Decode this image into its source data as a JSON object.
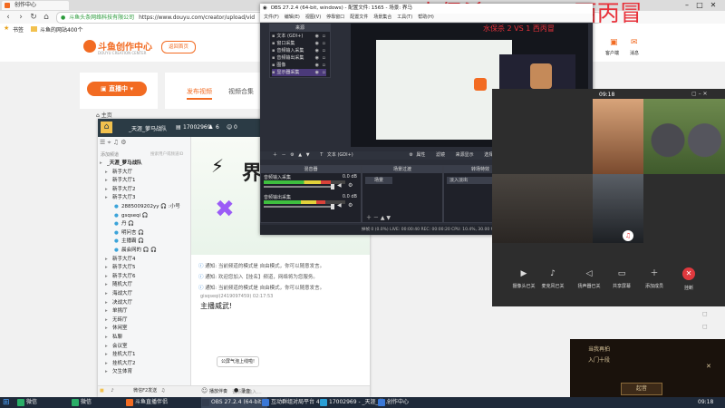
{
  "browser": {
    "tabs": [
      {
        "label": "创作中心"
      }
    ],
    "address": "https://www.douyu.com/creator/upload/vid",
    "address_prefix": "斗鱼头条网络科技有限公司",
    "bookmarks": [
      {
        "label": "书签"
      },
      {
        "label": "斗鱼的网站400个"
      }
    ]
  },
  "site": {
    "logo": "斗鱼创作中心",
    "logo_sub": "DOUYU CREATION CENTER",
    "back_btn": "返回首页",
    "live_btn": "直播中",
    "tab_upload": "发布视频",
    "tab_collection": "视频合集",
    "home": "主页",
    "right_icons": [
      {
        "label": "客户端"
      },
      {
        "label": "消息"
      }
    ]
  },
  "overlay_title": "水保杀 2 VS 1 西丙冒",
  "chat": {
    "channel_name": "_天涯_萝马战队",
    "channel_id": "17002969",
    "member_count": "6",
    "online": "0",
    "search_placeholder": "搜索用户或频道ID",
    "section_label": "添加频道",
    "channels": [
      {
        "label": "_天涯_萝马战队"
      },
      {
        "label": "新手大厅"
      },
      {
        "label": "新手大厅1"
      },
      {
        "label": "新手大厅2"
      },
      {
        "label": "新手大厅3"
      },
      {
        "label": "2885009202yy 🎧 :小号"
      },
      {
        "label": "gsqseqi 🎧"
      },
      {
        "label": "丹 🎧"
      },
      {
        "label": "明问言 🎧"
      },
      {
        "label": "主播霸 🎧"
      },
      {
        "label": "晨会网的 🎧 🎧"
      },
      {
        "label": "新手大厅4"
      },
      {
        "label": "新手大厅5"
      },
      {
        "label": "新手大厅6"
      },
      {
        "label": "随机大厅"
      },
      {
        "label": "海战大厅"
      },
      {
        "label": "决战大厅"
      },
      {
        "label": "单挑厅"
      },
      {
        "label": "无砖厅"
      },
      {
        "label": "休闲室"
      },
      {
        "label": "私聊"
      },
      {
        "label": "会议室"
      },
      {
        "label": "挂机大厅1"
      },
      {
        "label": "挂机大厅2"
      },
      {
        "label": "欠生体育"
      }
    ],
    "messages": [
      {
        "text": "通知: 当前频道的模式是 自由模式，你可以随意发言。"
      },
      {
        "text": "通知: 欢迎您加入【挂名】频道，网络将为您服务。"
      },
      {
        "text": "通知: 当前频道的模式是 自由模式，你可以随意发言。"
      }
    ],
    "user_line": "gisqseqi(2419097459)  02:17:53",
    "big_message": "主播威武!",
    "notice_bubble": "公屏气泡上线啦!",
    "input_placeholder": "请点击输入...",
    "bottom_tools": [
      {
        "label": "微信F2发送"
      },
      {
        "label": "播放伴奏"
      },
      {
        "label": "录音"
      }
    ]
  },
  "obs": {
    "title": "OBS 27.2.4 (64-bit, windows) - 配置文件: 1565 - 场景: 界马",
    "menu": [
      {
        "label": "文件(F)"
      },
      {
        "label": "编辑(E)"
      },
      {
        "label": "视图(V)"
      },
      {
        "label": "停靠窗口"
      },
      {
        "label": "配置文件"
      },
      {
        "label": "场景集合"
      },
      {
        "label": "工具(T)"
      },
      {
        "label": "帮助(H)"
      }
    ],
    "sources_header": "来源",
    "sources": [
      {
        "label": "文本 (GDI+)"
      },
      {
        "label": "窗口采集"
      },
      {
        "label": "音频输入采集"
      },
      {
        "label": "音频输出采集"
      },
      {
        "label": "图像"
      },
      {
        "label": "显示器采集"
      }
    ],
    "toolbar_text": "文本 (GDI+)",
    "toolbar_props": "属性",
    "toolbar_filter": "滤镜",
    "toolbar_scene": "来源显示",
    "toolbar_select": "选择场景",
    "mixer_header": "混音器",
    "mixer": [
      {
        "label": "音频输入采集",
        "level": "0.0 dB",
        "fill": 0.82
      },
      {
        "label": "音频输出采集",
        "level": "0.0 dB",
        "fill": 0.76
      }
    ],
    "scenes_header": "场景过渡",
    "scene_item": "场景",
    "transition_header": "转场特效",
    "transition_select": "淡入淡出",
    "controls_header": "控件",
    "controls": [
      {
        "label": "停止直播"
      },
      {
        "label": "停止录制"
      },
      {
        "label": "启动虚拟摄像机"
      },
      {
        "label": "工作室模式"
      },
      {
        "label": "设置"
      },
      {
        "label": "退出"
      }
    ],
    "status": "掉帧 0 (0.0%)   LIVE: 00:00:40   REC: 00:00:20   CPU: 10.4%, 30.00 fps   kb/s: 2499",
    "preview_scene_label": "水保杀 2 VS 1 西丙冒"
  },
  "call": {
    "time": "09:18",
    "controls": [
      {
        "label": "摄像头已关"
      },
      {
        "label": "麦克风已关"
      },
      {
        "label": "扬声器已关"
      },
      {
        "label": "共享屏幕"
      },
      {
        "label": "添加成员"
      },
      {
        "label": "挂断"
      }
    ]
  },
  "game": {
    "line1": "当我再拍",
    "line2": "入门十段",
    "button": "起音"
  },
  "taskbar": {
    "items": [
      {
        "label": "微信",
        "color": "#2aae67"
      },
      {
        "label": "微信",
        "color": "#2aae67"
      },
      {
        "label": "斗鱼直播伴侣",
        "color": "#f26b22"
      },
      {
        "label": "OBS 27.2.4 (64-bit...",
        "color": "#333d4f"
      },
      {
        "label": "互动群组对局平台 4...",
        "color": "#3a78d6"
      },
      {
        "label": "17002969 - _天涯_萝...",
        "color": "#2a9fd6"
      },
      {
        "label": "创作中心",
        "color": "#3a78d6"
      }
    ],
    "time": "09:18"
  },
  "colors": {
    "accent_orange": "#f26b22",
    "obs_bg": "#2b2e38",
    "overlay_red": "#e8313a"
  }
}
